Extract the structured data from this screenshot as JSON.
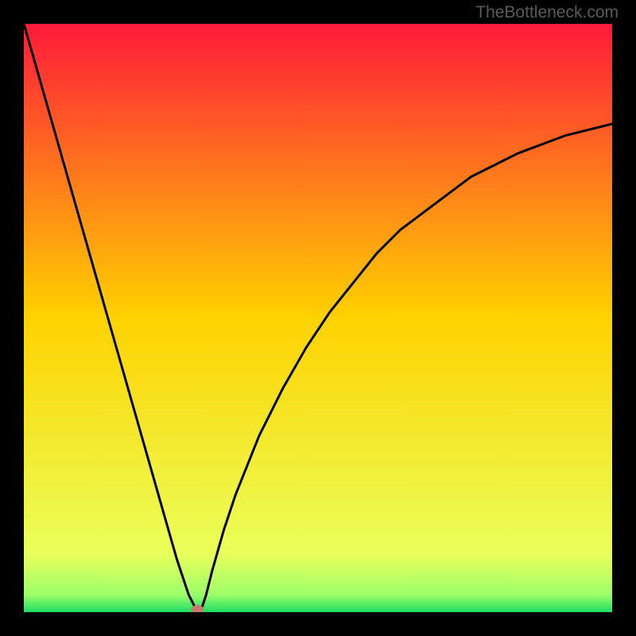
{
  "watermark": "TheBottleneck.com",
  "chart_data": {
    "type": "line",
    "title": "",
    "xlabel": "",
    "ylabel": "",
    "xlim": [
      0,
      100
    ],
    "ylim": [
      0,
      100
    ],
    "x": [
      0,
      2,
      4,
      6,
      8,
      10,
      12,
      14,
      16,
      18,
      20,
      22,
      24,
      26,
      27,
      28,
      29,
      30,
      31,
      32,
      34,
      36,
      38,
      40,
      44,
      48,
      52,
      56,
      60,
      64,
      68,
      72,
      76,
      80,
      84,
      88,
      92,
      96,
      100
    ],
    "values": [
      100,
      93,
      86,
      79,
      72,
      65,
      58,
      51,
      44,
      37,
      30,
      23,
      16,
      9,
      6,
      3,
      1,
      0,
      3,
      7,
      14,
      20,
      25,
      30,
      38,
      45,
      51,
      56,
      61,
      65,
      68,
      71,
      74,
      76,
      78,
      79.5,
      81,
      82,
      83
    ],
    "minimum_marker": {
      "x": 29.5,
      "y": 0
    },
    "background": {
      "type": "vertical_gradient",
      "stops": [
        {
          "pct": 0,
          "color": "#ff1a3a"
        },
        {
          "pct": 50,
          "color": "#ffd200"
        },
        {
          "pct": 90,
          "color": "#eaff5a"
        },
        {
          "pct": 97,
          "color": "#9eff6a"
        },
        {
          "pct": 100,
          "color": "#1fdc64"
        }
      ]
    }
  }
}
